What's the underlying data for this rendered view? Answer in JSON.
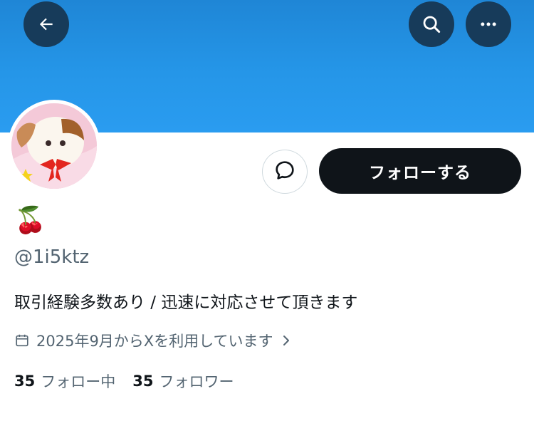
{
  "header": {
    "back_icon": "arrow-left-icon",
    "search_icon": "search-icon",
    "more_icon": "more-horizontal-icon",
    "banner_color": "#2596e8",
    "icon_button_color": "#173b5a"
  },
  "profile": {
    "display_name": "🍒",
    "handle": "@1i5ktz",
    "bio": "取引経験多数あり / 迅速に対応させて頂きます",
    "joined": "2025年9月からXを利用しています",
    "following_count": "35",
    "following_label": "フォロー中",
    "followers_count": "35",
    "followers_label": "フォロワー"
  },
  "actions": {
    "follow_label": "フォローする",
    "follow_button_color": "#0f1419",
    "message_icon": "message-bubble-icon"
  }
}
